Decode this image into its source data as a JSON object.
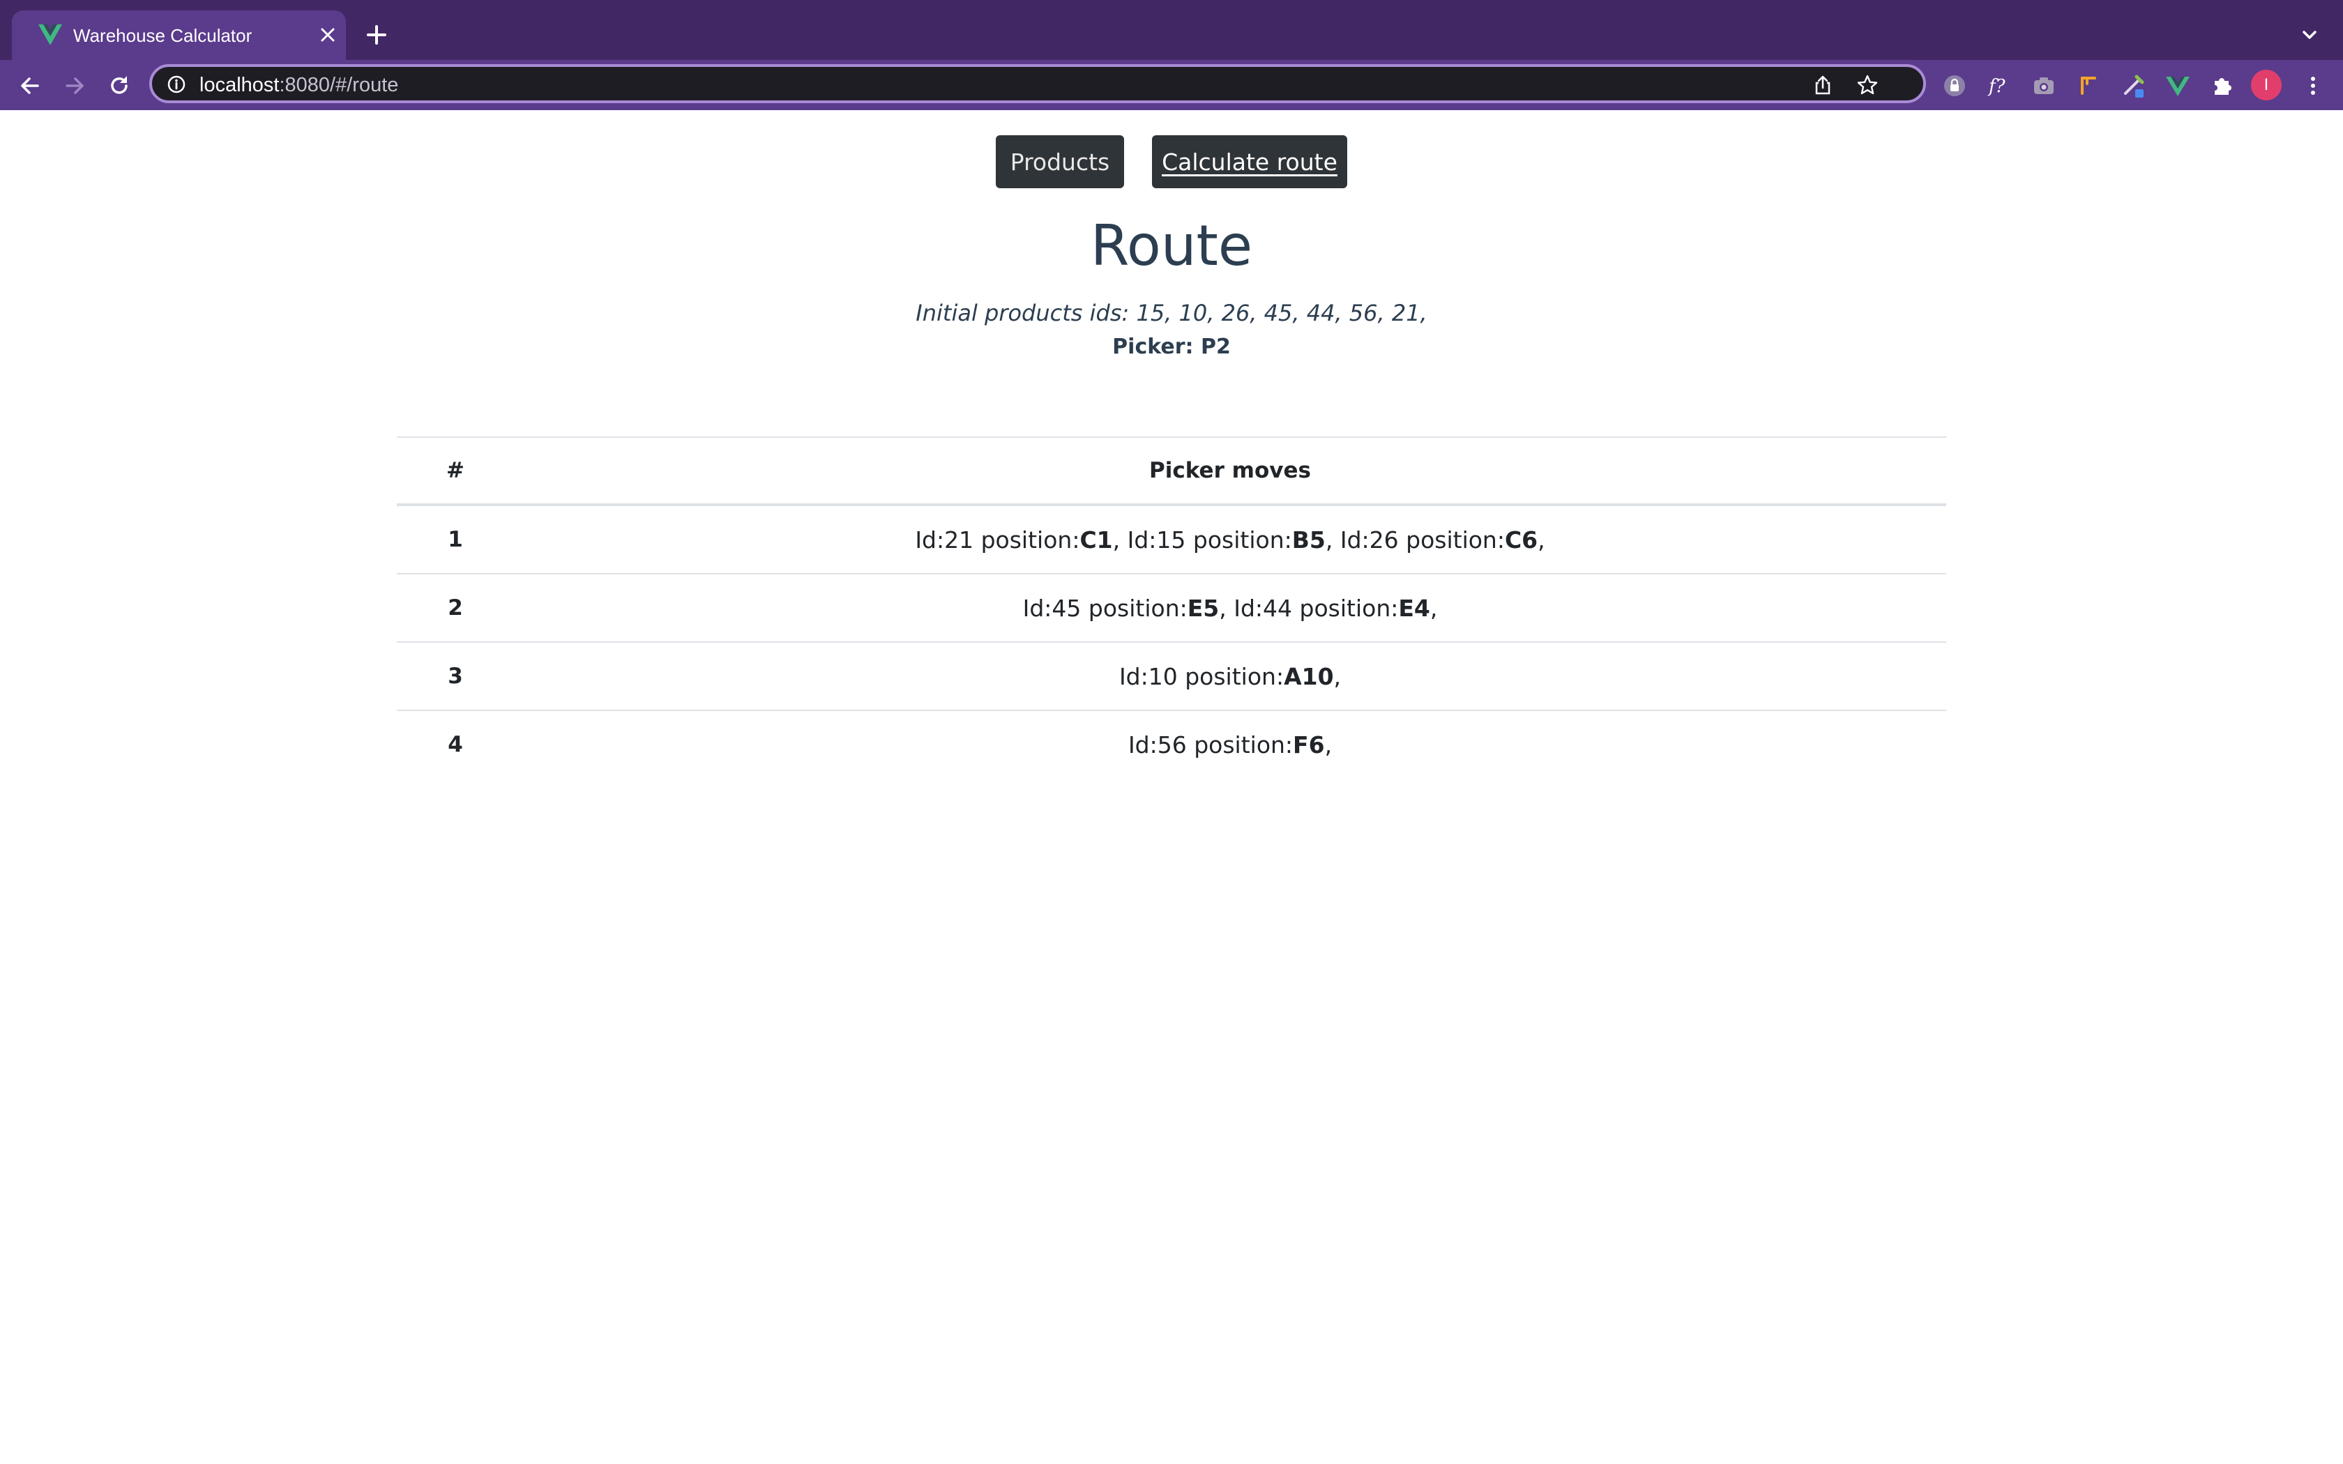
{
  "browser": {
    "tab_title": "Warehouse Calculator",
    "url_host": "localhost",
    "url_rest": ":8080/#/route",
    "avatar_letter": "I",
    "icons": [
      "vue-favicon-icon",
      "close-icon",
      "plus-icon",
      "chevron-down-icon",
      "back-icon",
      "forward-icon",
      "reload-icon",
      "info-icon",
      "share-icon",
      "star-icon",
      "extension-icons",
      "puzzle-icon",
      "kebab-menu-icon"
    ]
  },
  "nav": {
    "products_label": "Products",
    "route_label": "Calculate route"
  },
  "route": {
    "title": "Route",
    "subtitle": "Initial products ids: 15, 10, 26, 45, 44, 56, 21,",
    "picker": "Picker: P2"
  },
  "table": {
    "headers": [
      "#",
      "Picker moves"
    ],
    "rows": [
      {
        "n": "1",
        "moves": [
          {
            "id": "Id:21 position:",
            "pos": "C1"
          },
          {
            "id": "Id:15 position:",
            "pos": "B5"
          },
          {
            "id": "Id:26 position:",
            "pos": "C6"
          }
        ]
      },
      {
        "n": "2",
        "moves": [
          {
            "id": "Id:45 position:",
            "pos": "E5"
          },
          {
            "id": "Id:44 position:",
            "pos": "E4"
          }
        ]
      },
      {
        "n": "3",
        "moves": [
          {
            "id": "Id:10 position:",
            "pos": "A10"
          }
        ]
      },
      {
        "n": "4",
        "moves": [
          {
            "id": "Id:56 position:",
            "pos": "F6"
          }
        ]
      }
    ]
  },
  "colors": {
    "chrome_frame": "#412864",
    "chrome_toolbar": "#5b3b8c",
    "button_dark": "#2f3438",
    "heading_text": "#2c3e50"
  }
}
